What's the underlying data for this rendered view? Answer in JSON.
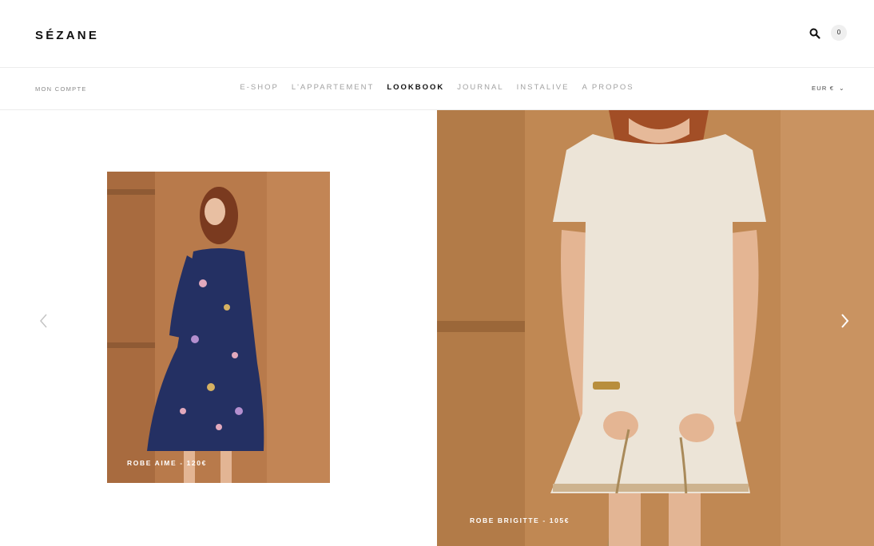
{
  "header": {
    "logo": "SÉZANE",
    "cart_count": "0"
  },
  "nav": {
    "account": "MON COMPTE",
    "items": [
      {
        "label": "E-SHOP"
      },
      {
        "label": "L'APPARTEMENT"
      },
      {
        "label": "LOOKBOOK",
        "active": true
      },
      {
        "label": "JOURNAL"
      },
      {
        "label": "INSTALIVE"
      },
      {
        "label": "A PROPOS"
      }
    ],
    "currency": "EUR €"
  },
  "looks": [
    {
      "caption": "ROBE AIME - 120€",
      "dress_color": "#243063",
      "background": "#b87a4b"
    },
    {
      "caption": "ROBE BRIGITTE - 105€",
      "dress_color": "#ece4d7",
      "background": "#c08853"
    }
  ],
  "icons": {
    "search": "search-icon",
    "prev": "chevron-left-icon",
    "next": "chevron-right-icon",
    "caret": "chevron-down-icon"
  }
}
